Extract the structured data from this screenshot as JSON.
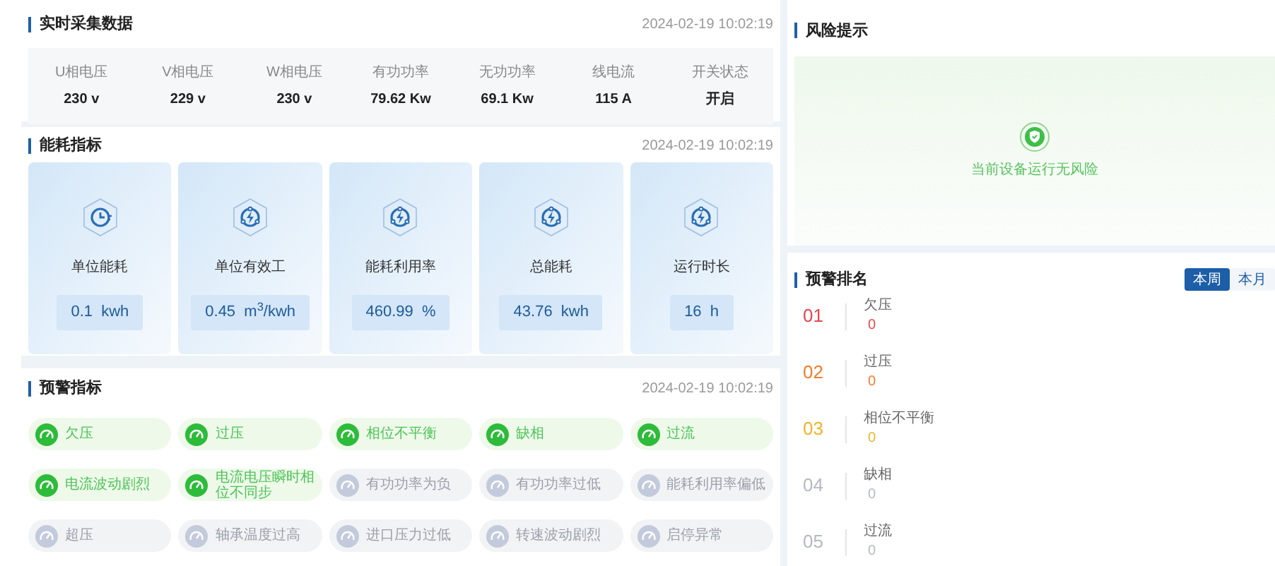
{
  "realtime": {
    "title": "实时采集数据",
    "time": "2024-02-19 10:02:19",
    "fields": [
      {
        "label": "U相电压",
        "value": "230 v"
      },
      {
        "label": "V相电压",
        "value": "229 v"
      },
      {
        "label": "W相电压",
        "value": "230 v"
      },
      {
        "label": "有功功率",
        "value": "79.62 Kw"
      },
      {
        "label": "无功功率",
        "value": "69.1 Kw"
      },
      {
        "label": "线电流",
        "value": "115 A"
      },
      {
        "label": "开关状态",
        "value": "开启"
      }
    ]
  },
  "energy": {
    "title": "能耗指标",
    "time": "2024-02-19 10:02:19",
    "cards": [
      {
        "kind": "clock",
        "label": "单位能耗",
        "value": "0.1  kwh"
      },
      {
        "kind": "bolt",
        "label": "单位有效工",
        "value": "0.45  m$^{3}$/kwh"
      },
      {
        "kind": "bolt",
        "label": "能耗利用率",
        "value": "460.99  %"
      },
      {
        "kind": "bolt",
        "label": "总能耗",
        "value": "43.76  kwh"
      },
      {
        "kind": "bolt",
        "label": "运行时长",
        "value": "16  h"
      }
    ]
  },
  "warnings": {
    "title": "预警指标",
    "time": "2024-02-19 10:02:19",
    "items": [
      {
        "label": "欠压",
        "active": true
      },
      {
        "label": "过压",
        "active": true
      },
      {
        "label": "相位不平衡",
        "active": true
      },
      {
        "label": "缺相",
        "active": true
      },
      {
        "label": "过流",
        "active": true
      },
      {
        "label": "电流波动剧烈",
        "active": true
      },
      {
        "label": "电流电压瞬时相位不同步",
        "active": true
      },
      {
        "label": "有功功率为负",
        "active": false
      },
      {
        "label": "有功功率过低",
        "active": false
      },
      {
        "label": "能耗利用率偏低",
        "active": false
      },
      {
        "label": "超压",
        "active": false
      },
      {
        "label": "轴承温度过高",
        "active": false
      },
      {
        "label": "进口压力过低",
        "active": false
      },
      {
        "label": "转速波动剧烈",
        "active": false
      },
      {
        "label": "启停异常",
        "active": false
      }
    ]
  },
  "risk": {
    "title": "风险提示",
    "message": "当前设备运行无风险"
  },
  "ranking": {
    "title": "预警排名",
    "tabs": [
      {
        "label": "本周",
        "selected": true
      },
      {
        "label": "本月",
        "selected": false
      }
    ],
    "items": [
      {
        "rank": "01",
        "label": "欠压",
        "count": "0",
        "color": "#e5484d"
      },
      {
        "rank": "02",
        "label": "过压",
        "count": "0",
        "color": "#f07c2c"
      },
      {
        "rank": "03",
        "label": "相位不平衡",
        "count": "0",
        "color": "#f0b429"
      },
      {
        "rank": "04",
        "label": "缺相",
        "count": "0",
        "color": "#b4b9c2"
      },
      {
        "rank": "05",
        "label": "过流",
        "count": "0",
        "color": "#b4b9c2"
      }
    ]
  }
}
